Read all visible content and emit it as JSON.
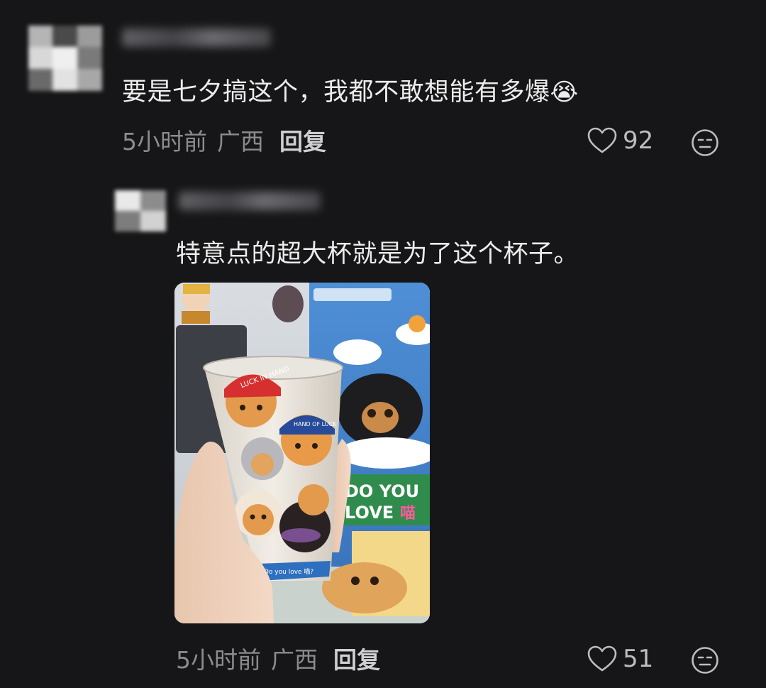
{
  "comments": [
    {
      "text": "要是七夕搞这个，我都不敢想能有多爆",
      "emoji": "😭",
      "time": "5小时前",
      "location": "广西",
      "reply_label": "回复",
      "likes": "92"
    },
    {
      "text": "特意点的超大杯就是为了这个杯子。",
      "time": "5小时前",
      "location": "广西",
      "reply_label": "回复",
      "likes": "51",
      "photo": {
        "cap_text": "LUCK IN HAND",
        "cap2_text": "HAND OF LUCK",
        "box_text": "DO YOU LOVE",
        "box_heart": "喵",
        "band_text": "Do you love 喵?"
      }
    }
  ],
  "icons": {
    "like": "heart-outline-icon",
    "react": "expressionless-face-icon"
  },
  "colors": {
    "background": "#161618",
    "text_primary": "#ececec",
    "text_meta": "#8c8c8e",
    "reply": "#cfcfd1"
  }
}
